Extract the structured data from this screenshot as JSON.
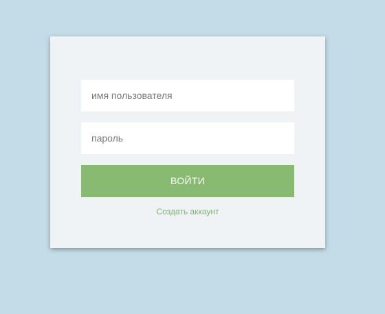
{
  "login_form": {
    "username_placeholder": "имя пользователя",
    "password_placeholder": "пароль",
    "submit_label": "ВОЙТИ",
    "create_account_label": "Создать аккаунт"
  },
  "colors": {
    "page_background": "#c4dce8",
    "card_background": "#eff3f6",
    "accent_green": "#88bb71",
    "link_green": "#7fb270"
  }
}
